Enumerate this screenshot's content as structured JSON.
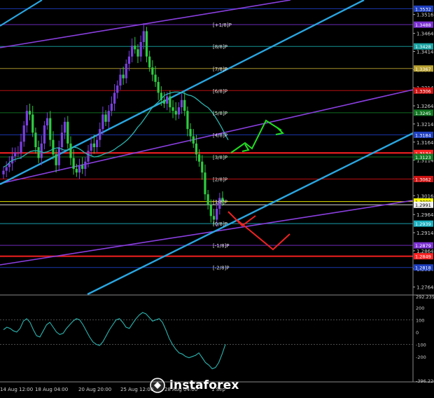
{
  "chart_data": [
    {
      "type": "candlestick",
      "title": "",
      "y_axis_ticks": [
        "1.3516",
        "1.3464",
        "1.3414",
        "1.3364",
        "1.3314",
        "1.3264",
        "1.3214",
        "1.3164",
        "1.3114",
        "1.3064",
        "1.3016",
        "1.2964",
        "1.2914",
        "1.2864",
        "1.2814",
        "1.2764"
      ],
      "price_level_tags": [
        {
          "value": "1.3532",
          "color": "#1e3fbf"
        },
        {
          "value": "1.3488",
          "color": "#7a2fd0"
        },
        {
          "value": "1.3428",
          "color": "#1aa3a3"
        },
        {
          "value": "1.3367",
          "color": "#b8a030"
        },
        {
          "value": "1.3306",
          "color": "#cc1111"
        },
        {
          "value": "1.3245",
          "color": "#117722"
        },
        {
          "value": "1.3184",
          "color": "#1e3fbf"
        },
        {
          "value": "1.3134",
          "color": "#ff2222"
        },
        {
          "value": "1.3123",
          "color": "#117722"
        },
        {
          "value": "1.3062",
          "color": "#cc1111"
        },
        {
          "value": "1.3000",
          "color": "#ffff00"
        },
        {
          "value": "1.2991",
          "color": "#f0f0f0"
        },
        {
          "value": "1.2939",
          "color": "#1ab0c0"
        },
        {
          "value": "1.2879",
          "color": "#7a2fd0"
        },
        {
          "value": "1.2849",
          "color": "#ff2222"
        },
        {
          "value": "1.2818",
          "color": "#1e3fbf"
        }
      ],
      "murrey_labels": [
        {
          "text": "[+1/8]P",
          "level": 1.3488
        },
        {
          "text": "[8/8]P",
          "level": 1.3428
        },
        {
          "text": "[7/8]P",
          "level": 1.3367
        },
        {
          "text": "[6/8]P",
          "level": 1.3306
        },
        {
          "text": "[5/8]P",
          "level": 1.3245
        },
        {
          "text": "[4/8]P",
          "level": 1.3184
        },
        {
          "text": "[3/8]P",
          "level": 1.3123
        },
        {
          "text": "[2/8]P",
          "level": 1.3062
        },
        {
          "text": "[1/8]P",
          "level": 1.3
        },
        {
          "text": "[0/8]P",
          "level": 1.2939
        },
        {
          "text": "[-1/8]P",
          "level": 1.2879
        },
        {
          "text": "[-2/8]P",
          "level": 1.2818
        }
      ],
      "x_axis_labels": [
        "14 Aug 12:00",
        "18 Aug 04:00",
        "20 Aug 20:00",
        "25 Aug 12:00",
        "28 Aug 04:00",
        "1 Sep"
      ],
      "y_range": [
        1.2744,
        1.3556
      ],
      "grid": false,
      "series": [
        {
          "type": "candles",
          "close": [
            1.3085,
            1.3095,
            1.3105,
            1.3125,
            1.3135,
            1.3135,
            1.3165,
            1.321,
            1.325,
            1.324,
            1.319,
            1.315,
            1.312,
            1.316,
            1.321,
            1.323,
            1.317,
            1.313,
            1.31,
            1.315,
            1.319,
            1.322,
            1.316,
            1.312,
            1.309,
            1.308,
            1.31,
            1.309,
            1.311,
            1.314,
            1.316,
            1.315,
            1.317,
            1.32,
            1.324,
            1.322,
            1.325,
            1.327,
            1.33,
            1.332,
            1.335,
            1.334,
            1.338,
            1.34,
            1.343,
            1.342,
            1.34,
            1.344,
            1.347,
            1.34,
            1.337,
            1.335,
            1.333,
            1.33,
            1.328,
            1.327,
            1.329,
            1.326,
            1.325,
            1.324,
            1.326,
            1.328,
            1.325,
            1.32,
            1.318,
            1.316,
            1.313,
            1.311,
            1.308,
            1.302,
            1.299,
            1.296,
            1.295,
            1.298,
            1.301,
            1.3
          ]
        },
        {
          "type": "moving_average",
          "color": "#2bb5b0",
          "values": [
            1.3095,
            1.31,
            1.311,
            1.3115,
            1.3118,
            1.312,
            1.3126,
            1.3132,
            1.3138,
            1.314,
            1.314,
            1.3138,
            1.3135,
            1.3137,
            1.3141,
            1.3146,
            1.3148,
            1.3146,
            1.3142,
            1.3142,
            1.3146,
            1.315,
            1.3148,
            1.3143,
            1.3136,
            1.313,
            1.3127,
            1.3123,
            1.3124,
            1.3127,
            1.3131,
            1.3134,
            1.3138,
            1.3143,
            1.315,
            1.3156,
            1.3163,
            1.3171,
            1.3181,
            1.3192,
            1.3205,
            1.3215,
            1.3228,
            1.3241,
            1.3255,
            1.3265,
            1.3273,
            1.3283,
            1.3293,
            1.3297,
            1.33,
            1.3302,
            1.3302,
            1.3301,
            1.3298,
            1.3294,
            1.3292,
            1.3287,
            1.328,
            1.3272,
            1.3265,
            1.3259,
            1.3249,
            1.3236,
            1.3221,
            1.3205,
            1.3187,
            1.317
          ]
        },
        {
          "type": "forecast",
          "direction": "up",
          "color": "#22dd22"
        },
        {
          "type": "forecast",
          "direction": "down",
          "color": "#ee2222"
        }
      ]
    },
    {
      "type": "line",
      "title": "CCI",
      "y_axis_ticks": [
        "292.2359",
        "200",
        "100",
        "0",
        "-100",
        "-200",
        "-396.2263"
      ],
      "y_range": [
        -396.2263,
        292.2359
      ],
      "grid": false,
      "series": [
        {
          "name": "",
          "color": "#2bb5b0",
          "values": [
            20,
            40,
            30,
            10,
            0,
            30,
            90,
            110,
            80,
            20,
            -30,
            -40,
            10,
            60,
            80,
            40,
            0,
            -20,
            -10,
            30,
            60,
            90,
            110,
            100,
            60,
            10,
            -40,
            -80,
            -100,
            -110,
            -80,
            -30,
            20,
            60,
            100,
            110,
            80,
            40,
            30,
            70,
            110,
            140,
            160,
            150,
            120,
            90,
            100,
            110,
            80,
            20,
            -50,
            -100,
            -140,
            -170,
            -180,
            -200,
            -210,
            -200,
            -190,
            -170,
            -210,
            -250,
            -270,
            -300,
            -290,
            -250,
            -180,
            -100
          ]
        }
      ]
    }
  ],
  "branding": {
    "logo_text": "instaforex"
  },
  "colors": {
    "background": "#000000",
    "bull": "#7a3fe0",
    "bear": "#2ecc40",
    "axis": "#bbbbbb"
  }
}
